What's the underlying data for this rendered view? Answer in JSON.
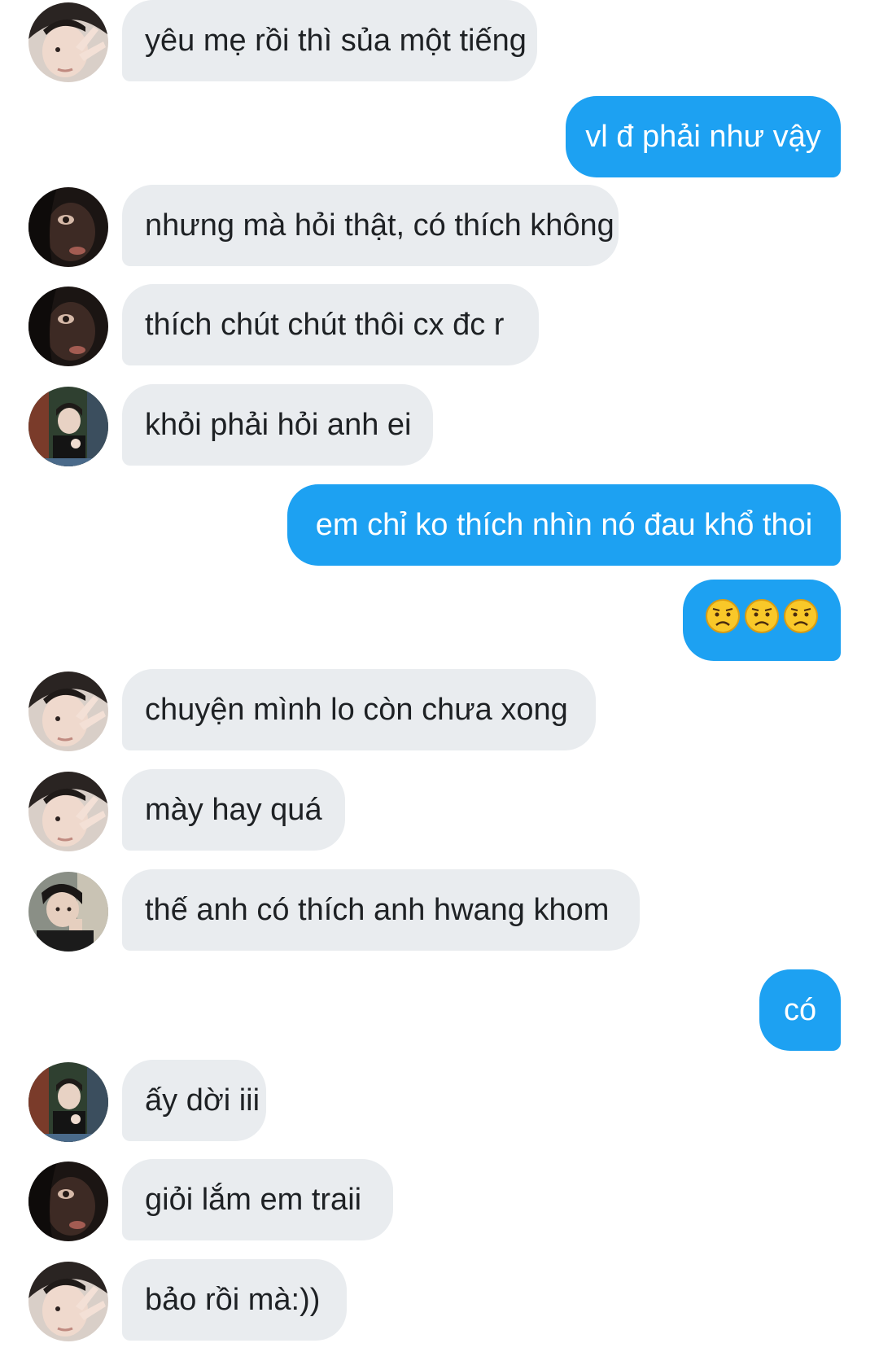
{
  "conversation": {
    "messages": [
      {
        "text": "yêu mẹ rồi thì sủa một tiếng",
        "direction": "incoming",
        "avatar": "avatar-peace-sign"
      },
      {
        "text": "vl đ phải như vậy",
        "direction": "outgoing"
      },
      {
        "text": "nhưng mà hỏi thật, có thích không",
        "direction": "incoming",
        "avatar": "avatar-dark-hood"
      },
      {
        "text": "thích chút chút thôi cx đc r",
        "direction": "incoming",
        "avatar": "avatar-dark-hood"
      },
      {
        "text": "khỏi phải hỏi anh ei",
        "direction": "incoming",
        "avatar": "avatar-train-seat"
      },
      {
        "text": "em chỉ ko thích nhìn nó đau khổ thoi",
        "direction": "outgoing"
      },
      {
        "text": "😟😟😟",
        "direction": "outgoing",
        "emoji": "worried-face"
      },
      {
        "text": "chuyện mình lo còn chưa xong",
        "direction": "incoming",
        "avatar": "avatar-peace-sign"
      },
      {
        "text": "mày hay quá",
        "direction": "incoming",
        "avatar": "avatar-peace-sign"
      },
      {
        "text": "thế anh có thích anh hwang khom",
        "direction": "incoming",
        "avatar": "avatar-bus-window"
      },
      {
        "text": "có",
        "direction": "outgoing"
      },
      {
        "text": "ấy dời iii",
        "direction": "incoming",
        "avatar": "avatar-train-seat"
      },
      {
        "text": "giỏi lắm em traii",
        "direction": "incoming",
        "avatar": "avatar-dark-hood"
      },
      {
        "text": "bảo rồi mà:))",
        "direction": "incoming",
        "avatar": "avatar-peace-sign"
      }
    ]
  },
  "colors": {
    "incoming_bubble": "#e9ecef",
    "outgoing_bubble": "#1da1f2",
    "incoming_text": "#1e2124",
    "outgoing_text": "#ffffff"
  }
}
